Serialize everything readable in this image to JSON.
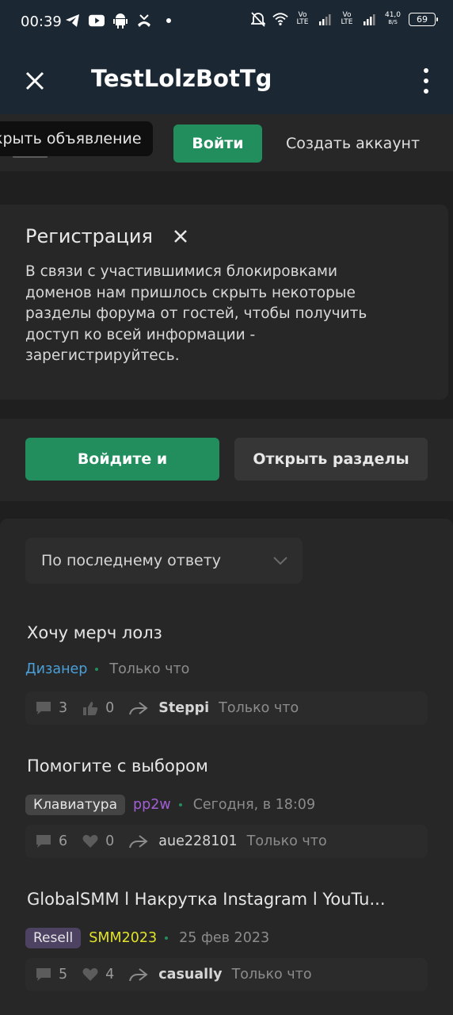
{
  "status_bar": {
    "time": "00:39",
    "net_speed_value": "41,0",
    "net_speed_unit": "B/S",
    "battery": "69",
    "sim1_label": "Vo LTE",
    "sim2_label": "Vo LTE"
  },
  "app_bar": {
    "title": "TestLolzBotTg"
  },
  "header": {
    "tooltip": "крыть объявление",
    "login_label": "Войти",
    "create_label": "Создать аккаунт"
  },
  "registration": {
    "title": "Регистрация",
    "text": "В связи с участившимися блокировками доменов нам пришлось скрыть некоторые разделы форума от гостей, чтобы получить доступ ко всей информации - зарегистрируйтесь."
  },
  "actions": {
    "primary_label": "Войдите и",
    "secondary_label": "Открыть разделы"
  },
  "sort": {
    "selected": "По последнему ответу"
  },
  "threads": [
    {
      "title": "Хочу мерч лолз",
      "tag": "",
      "author": "Дизанер",
      "author_color": "#4a9fd8",
      "time": "Только что",
      "replies": "3",
      "likes": "0",
      "last_replier": "Steppi",
      "last_reply_time": "Только что"
    },
    {
      "title": "Помогите с выбором",
      "tag": "Клавиатура",
      "author": "pp2w",
      "author_color": "#a35ed6",
      "time": "Сегодня, в 18:09",
      "replies": "6",
      "likes": "0",
      "last_replier": "aue228101",
      "last_reply_time": "Только что"
    },
    {
      "title": "GlobalSMM l Накрутка Instagram l YouTu...",
      "tag": "Resell",
      "author": "SMM2023",
      "author_color": "#e2e22a",
      "time": "25 фев 2023",
      "replies": "5",
      "likes": "4",
      "last_replier": "casually",
      "last_reply_time": "Только что"
    }
  ],
  "colors": {
    "accent_green": "#228e5d",
    "app_bar": "#1b2733",
    "card": "#272727",
    "background": "#1f1f1f"
  }
}
